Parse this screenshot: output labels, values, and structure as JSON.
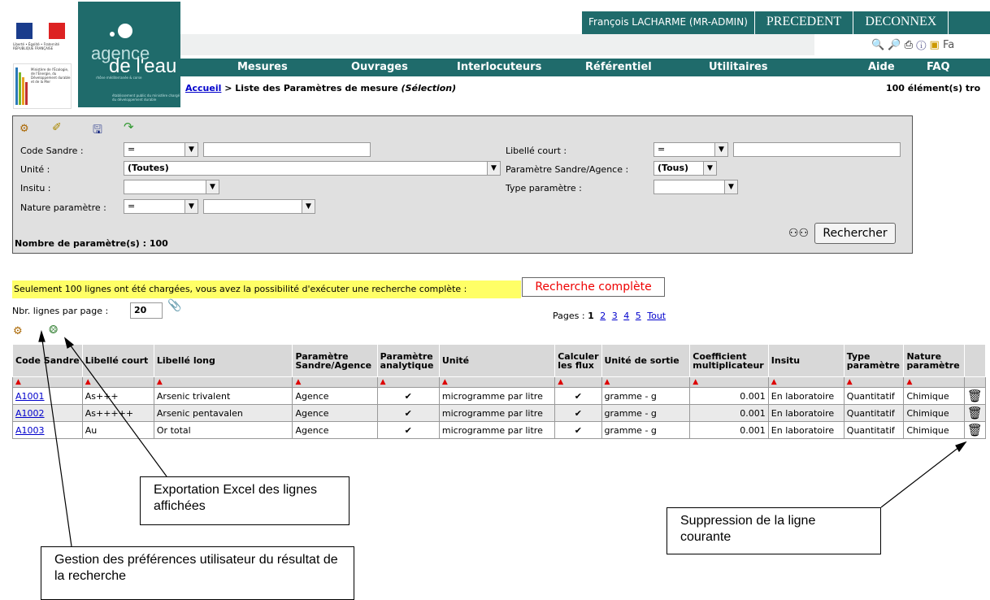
{
  "header": {
    "republique_text": "Liberté • Égalité • Fraternité RÉPUBLIQUE FRANÇAISE",
    "agence_word1": "agence",
    "agence_word2": "de l'eau",
    "agence_sub": "rhône méditerranée & corse",
    "agence_etab": "établissement public du ministère chargé du développement durable",
    "ministere_text": "Ministère de l'Écologie, de l'Énergie, du Développement durable et de la Mer",
    "user_name": "François LACHARME (MR-ADMIN)",
    "btn_precedent": "PRECEDENT",
    "btn_deconnex": "DECONNEX",
    "tool_fa": "Fa"
  },
  "menu": {
    "mesures": "Mesures",
    "ouvrages": "Ouvrages",
    "interlocuteurs": "Interlocuteurs",
    "referentiel": "Référentiel",
    "utilitaires": "Utilitaires",
    "aide": "Aide",
    "faq": "FAQ"
  },
  "breadcrumb": {
    "home": "Accueil",
    "sep": " > ",
    "page": "Liste des Paramètres de mesure",
    "mode": "(Sélection)",
    "count": "100 élément(s) tro"
  },
  "search": {
    "code_sandre_label": "Code Sandre :",
    "code_sandre_op": "=",
    "libelle_court_label": "Libellé court :",
    "libelle_court_op": "=",
    "unite_label": "Unité :",
    "unite_value": "(Toutes)",
    "param_sa_label": "Paramètre Sandre/Agence :",
    "param_sa_value": "(Tous)",
    "insitu_label": "Insitu :",
    "type_param_label": "Type paramètre :",
    "nature_label": "Nature paramètre :",
    "nature_op": "=",
    "result_count": "Nombre de paramètre(s) : 100",
    "search_button": "Rechercher"
  },
  "notice": {
    "warning": "Seulement 100 lignes ont été chargées, vous avez la possibilité d'exécuter une recherche complète :",
    "full_search_button": "Recherche complète",
    "per_page_label": "Nbr. lignes par page :",
    "per_page_value": "20",
    "pages_label": "Pages :",
    "current_page": "1",
    "pages": [
      "2",
      "3",
      "4",
      "5"
    ],
    "all_pages": "Tout"
  },
  "table": {
    "headers": {
      "code": "Code Sandre",
      "libelle_court": "Libellé court",
      "libelle_long": "Libellé long",
      "param_sa": "Paramètre Sandre/Agence",
      "param_analytique": "Paramètre analytique",
      "unite": "Unité",
      "calculer_flux": "Calculer les flux",
      "unite_sortie": "Unité de sortie",
      "coef": "Coefficient multiplicateur",
      "insitu": "Insitu",
      "type_param": "Type paramètre",
      "nature_param": "Nature paramètre"
    },
    "rows": [
      {
        "code": "A1001",
        "court": "As+++",
        "long": "Arsenic trivalent",
        "sa": "Agence",
        "analytique": "✔",
        "unite": "microgramme par litre",
        "flux": "✔",
        "sortie": "gramme - g",
        "coef": "0.001",
        "insitu": "En laboratoire",
        "type": "Quantitatif",
        "nature": "Chimique"
      },
      {
        "code": "A1002",
        "court": "As+++++",
        "long": "Arsenic pentavalen",
        "sa": "Agence",
        "analytique": "✔",
        "unite": "microgramme par litre",
        "flux": "✔",
        "sortie": "gramme - g",
        "coef": "0.001",
        "insitu": "En laboratoire",
        "type": "Quantitatif",
        "nature": "Chimique"
      },
      {
        "code": "A1003",
        "court": "Au",
        "long": "Or total",
        "sa": "Agence",
        "analytique": "✔",
        "unite": "microgramme par litre",
        "flux": "✔",
        "sortie": "gramme - g",
        "coef": "0.001",
        "insitu": "En laboratoire",
        "type": "Quantitatif",
        "nature": "Chimique"
      }
    ]
  },
  "callouts": {
    "export": "Exportation Excel des lignes affichées",
    "delete": "Suppression de la ligne courante",
    "prefs": "Gestion des préférences utilisateur du résultat de la recherche"
  },
  "colors": {
    "brand": "#1f6b6b",
    "warning_bg": "#ffff66",
    "link": "#0000cc"
  }
}
